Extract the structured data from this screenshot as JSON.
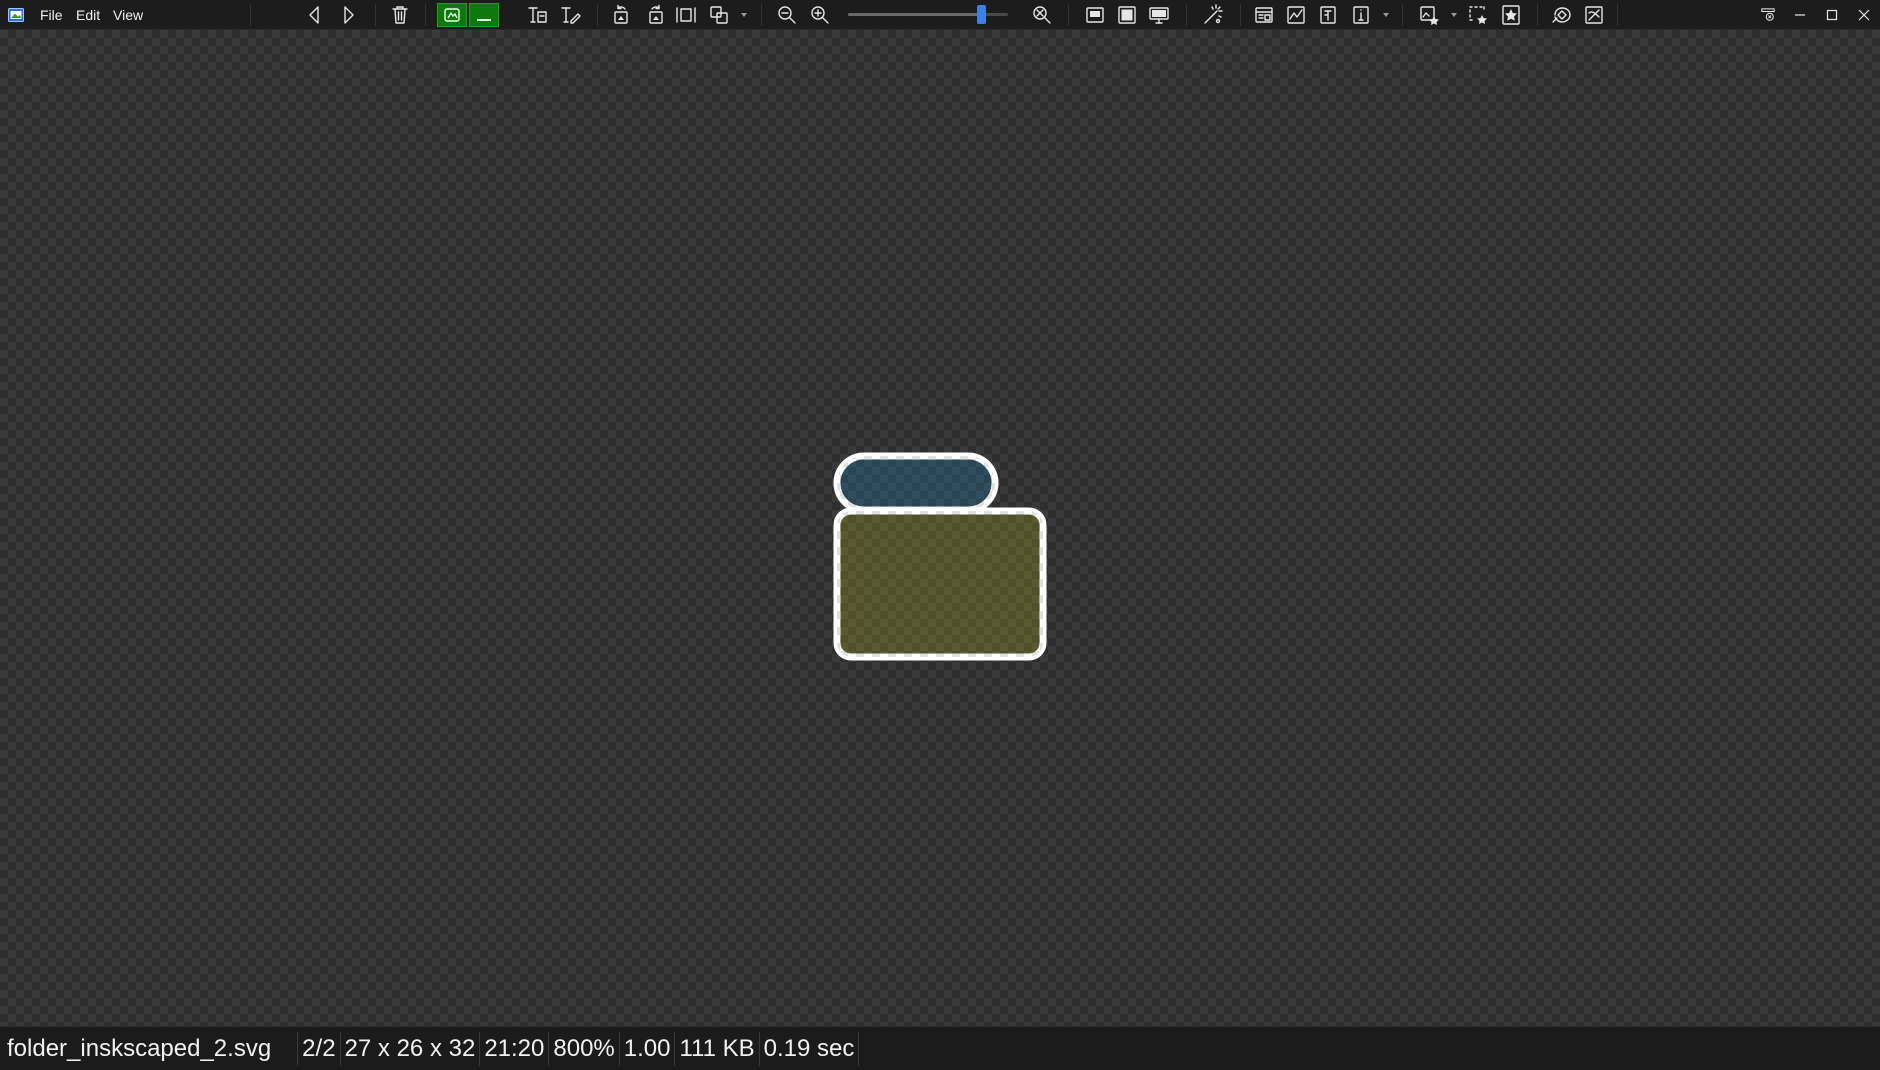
{
  "menu": {
    "file": "File",
    "edit": "Edit",
    "view": "View"
  },
  "toolbar": {
    "icons": [
      "previous-icon",
      "next-icon",
      "delete-icon",
      "view-mode-icon",
      "channel-icon",
      "rename-icon",
      "edit-text-icon",
      "rotate-left-icon",
      "rotate-right-icon",
      "fit-icon",
      "crop-icon",
      "zoom-out-icon",
      "zoom-in-icon",
      "zoom-reset-icon",
      "window-icon",
      "fill-window-icon",
      "fullscreen-icon",
      "effects-icon",
      "info-icon",
      "histogram-icon",
      "metadata-icon",
      "properties-icon",
      "favorites-icon",
      "select-icon",
      "star-icon",
      "tools-icon",
      "fit-screen-icon"
    ],
    "zoom_slider_fraction": 0.83,
    "accent_color": "#0b7a0b",
    "slider_color": "#3b82e6"
  },
  "window_controls": {
    "icons": [
      "pin-icon",
      "minimize-icon",
      "maximize-icon",
      "close-icon"
    ]
  },
  "status": {
    "filename": "folder_inskscaped_2.svg",
    "index": "2/2",
    "dimensions": "27 x 26 x 32",
    "time": "21:20",
    "zoom": "800%",
    "gamma": "1.00",
    "filesize": "111 KB",
    "load_time": "0.19 sec"
  },
  "image": {
    "tab_fill": "#2f4f5f",
    "body_fill": "#5a5a30",
    "stroke": "#ffffff"
  }
}
